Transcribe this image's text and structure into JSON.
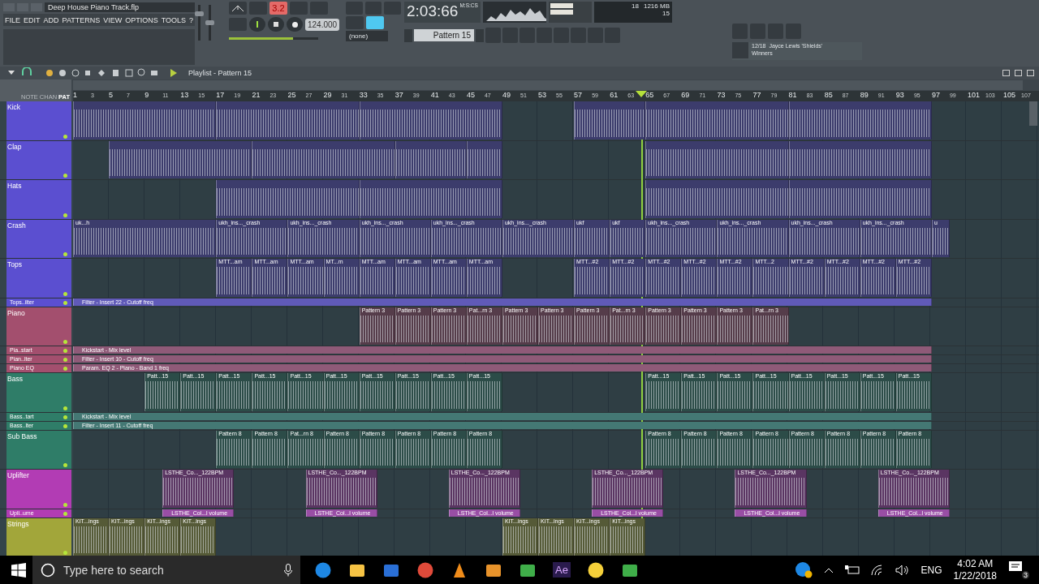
{
  "window": {
    "title": "Deep House Piano Track.flp"
  },
  "menu": [
    "FILE",
    "EDIT",
    "ADD",
    "PATTERNS",
    "VIEW",
    "OPTIONS",
    "TOOLS",
    "?"
  ],
  "master": {
    "volume": {
      "level": 0.8
    },
    "pitch": {
      "level": 0.5
    }
  },
  "transport": {
    "mode_button": "3.2",
    "playing": true,
    "tempo": "124.000",
    "pattern_picker": "(none)",
    "time": "2:03:66",
    "time_units": "M:S:CS",
    "position": {
      "level": 0.72
    }
  },
  "pattern_selector": "Pattern 15",
  "monitor": {
    "cpu": "18",
    "memory": "1216 MB",
    "polyphony": "15"
  },
  "hint": {
    "counter": "12/18",
    "title": "Jayce Lewis 'Shields'",
    "subtitle": "Winners"
  },
  "playlist": {
    "title": "Playlist - Pattern 15",
    "modes": [
      {
        "label": "NOTE",
        "selected": false
      },
      {
        "label": "CHAN",
        "selected": false
      },
      {
        "label": "PAT",
        "selected": true
      }
    ],
    "ruler": [
      "1",
      "3",
      "5",
      "7",
      "9",
      "11",
      "13",
      "15",
      "17",
      "19",
      "21",
      "23",
      "25",
      "27",
      "29",
      "31",
      "33",
      "35",
      "37",
      "39",
      "41",
      "43",
      "45",
      "47",
      "49",
      "51",
      "53",
      "55",
      "57",
      "59",
      "61",
      "63",
      "65",
      "67",
      "69",
      "71",
      "73",
      "75",
      "77",
      "79",
      "81",
      "83",
      "85",
      "87",
      "89",
      "91",
      "93",
      "95",
      "97",
      "99",
      "101",
      "103",
      "105",
      "107"
    ],
    "playhead": {
      "level": 0.594
    },
    "tracks": [
      {
        "name": "Kick",
        "kind": "main",
        "color": "#5b4fd0",
        "clips": [
          {
            "kind": "block"
          },
          {
            "kind": "block"
          },
          {
            "kind": "block"
          },
          {
            "kind": "rest"
          },
          {
            "kind": "rest"
          },
          {
            "kind": "longclip"
          },
          {
            "kind": "block"
          },
          {
            "kind": "block"
          }
        ]
      },
      {
        "name": "Clap",
        "kind": "main",
        "color": "#5b4fd0",
        "clips": [
          {
            "kind": "rest"
          },
          {
            "kind": "block"
          },
          {
            "kind": "block"
          },
          {
            "kind": "longclip"
          },
          {
            "kind": "clip"
          },
          {
            "kind": "rest"
          },
          {
            "kind": "rest"
          },
          {
            "kind": "rest"
          },
          {
            "kind": "rest"
          },
          {
            "kind": "block"
          },
          {
            "kind": "block"
          }
        ]
      },
      {
        "name": "Hats",
        "kind": "main",
        "color": "#5b4fd0",
        "clips": [
          {
            "kind": "rest"
          },
          {
            "kind": "rest"
          },
          {
            "kind": "rest"
          },
          {
            "kind": "rest"
          },
          {
            "kind": "block"
          },
          {
            "kind": "block"
          },
          {
            "kind": "rest"
          },
          {
            "kind": "rest"
          },
          {
            "kind": "rest"
          },
          {
            "kind": "rest"
          },
          {
            "kind": "block"
          },
          {
            "kind": "block"
          }
        ]
      },
      {
        "name": "Crash",
        "kind": "main",
        "color": "#5b4fd0",
        "clips": [
          {
            "kind": "block",
            "label": "uk...h"
          },
          {
            "kind": "longclip",
            "label": "ukh_ins..._crash"
          },
          {
            "kind": "longclip",
            "label": "ukh_ins..._crash"
          },
          {
            "kind": "longclip",
            "label": "ukh_ins..._crash"
          },
          {
            "kind": "longclip",
            "label": "ukh_ins..._crash"
          },
          {
            "kind": "longclip",
            "label": "ukh_ins..._crash"
          },
          {
            "kind": "clip",
            "label": "ukf"
          },
          {
            "kind": "clip",
            "label": "ukf"
          },
          {
            "kind": "longclip",
            "label": "ukh_ins..._crash"
          },
          {
            "kind": "longclip",
            "label": "ukh_ins..._crash"
          },
          {
            "kind": "longclip",
            "label": "ukh_ins..._crash"
          },
          {
            "kind": "longclip",
            "label": "ukh_ins..._crash"
          },
          {
            "kind": "halfclip",
            "label": "u"
          }
        ]
      },
      {
        "name": "Tops",
        "kind": "main",
        "color": "#5b4fd0",
        "clips": [
          {
            "kind": "rest"
          },
          {
            "kind": "rest"
          },
          {
            "kind": "rest"
          },
          {
            "kind": "rest"
          },
          {
            "kind": "clip",
            "label": "MTT...am"
          },
          {
            "kind": "clip",
            "label": "MTT...am"
          },
          {
            "kind": "clip",
            "label": "MTT...am"
          },
          {
            "kind": "clip",
            "label": "MT...m"
          },
          {
            "kind": "clip",
            "label": "MTT...am"
          },
          {
            "kind": "clip",
            "label": "MTT...am"
          },
          {
            "kind": "clip",
            "label": "MTT...am"
          },
          {
            "kind": "clip",
            "label": "MTT...am"
          },
          {
            "kind": "rest"
          },
          {
            "kind": "rest"
          },
          {
            "kind": "clip",
            "label": "MTT...#2"
          },
          {
            "kind": "clip",
            "label": "MTT...#2"
          },
          {
            "kind": "clip",
            "label": "MTT...#2"
          },
          {
            "kind": "clip",
            "label": "MTT...#2"
          },
          {
            "kind": "clip",
            "label": "MTT...#2"
          },
          {
            "kind": "clip",
            "label": "MTT...2"
          },
          {
            "kind": "clip",
            "label": "MTT...#2"
          },
          {
            "kind": "clip",
            "label": "MTT...#2"
          },
          {
            "kind": "clip",
            "label": "MTT...#2"
          },
          {
            "kind": "clip",
            "label": "MTT...#2"
          }
        ]
      },
      {
        "name": "Tops..ilter",
        "kind": "automation",
        "color": "#5b4fd0",
        "clips": [
          {
            "kind": "full",
            "label": "Filter - Insert 22 - Cutoff freq"
          }
        ]
      },
      {
        "name": "Piano",
        "kind": "main",
        "color": "#a34f6e",
        "clips": [
          {
            "kind": "rest"
          },
          {
            "kind": "rest"
          },
          {
            "kind": "rest"
          },
          {
            "kind": "rest"
          },
          {
            "kind": "rest"
          },
          {
            "kind": "rest"
          },
          {
            "kind": "rest"
          },
          {
            "kind": "rest"
          },
          {
            "kind": "clip",
            "label": "Pattern 3"
          },
          {
            "kind": "clip",
            "label": "Pattern 3"
          },
          {
            "kind": "clip",
            "label": "Pattern 3"
          },
          {
            "kind": "clip",
            "label": "Pat...rn 3"
          },
          {
            "kind": "clip",
            "label": "Pattern 3"
          },
          {
            "kind": "clip",
            "label": "Pattern 3"
          },
          {
            "kind": "clip",
            "label": "Pattern 3"
          },
          {
            "kind": "clip",
            "label": "Pat...rn 3"
          },
          {
            "kind": "clip",
            "label": "Pattern 3"
          },
          {
            "kind": "clip",
            "label": "Pattern 3"
          },
          {
            "kind": "clip",
            "label": "Pattern 3"
          },
          {
            "kind": "clip",
            "label": "Pat...rn 3"
          }
        ]
      },
      {
        "name": "Pia..start",
        "kind": "automation",
        "color": "#a34f6e",
        "clips": [
          {
            "kind": "full",
            "label": "Kickstart - Mix level"
          }
        ]
      },
      {
        "name": "Pian..lter",
        "kind": "automation",
        "color": "#a34f6e",
        "clips": [
          {
            "kind": "full",
            "label": "Filter - Insert 10 - Cutoff freq"
          }
        ]
      },
      {
        "name": "Piano EQ",
        "kind": "automation",
        "color": "#a34f6e",
        "clips": [
          {
            "kind": "full",
            "label": "Param. EQ 2 - Piano - Band 1 freq"
          }
        ]
      },
      {
        "name": "Bass",
        "kind": "main",
        "color": "#2f7d68",
        "clips": [
          {
            "kind": "rest"
          },
          {
            "kind": "rest"
          },
          {
            "kind": "clip",
            "label": "Patt...15"
          },
          {
            "kind": "clip",
            "label": "Patt...15"
          },
          {
            "kind": "clip",
            "label": "Patt...15"
          },
          {
            "kind": "clip",
            "label": "Patt...15"
          },
          {
            "kind": "clip",
            "label": "Patt...15"
          },
          {
            "kind": "clip",
            "label": "Patt...15"
          },
          {
            "kind": "clip",
            "label": "Patt...15"
          },
          {
            "kind": "clip",
            "label": "Patt...15"
          },
          {
            "kind": "clip",
            "label": "Patt...15"
          },
          {
            "kind": "clip",
            "label": "Patt...15"
          },
          {
            "kind": "rest"
          },
          {
            "kind": "rest"
          },
          {
            "kind": "rest"
          },
          {
            "kind": "rest"
          },
          {
            "kind": "clip",
            "label": "Patt...15"
          },
          {
            "kind": "clip",
            "label": "Patt...15"
          },
          {
            "kind": "clip",
            "label": "Patt...15"
          },
          {
            "kind": "clip",
            "label": "Patt...15"
          },
          {
            "kind": "clip",
            "label": "Patt...15"
          },
          {
            "kind": "clip",
            "label": "Patt...15"
          },
          {
            "kind": "clip",
            "label": "Patt...15"
          },
          {
            "kind": "clip",
            "label": "Patt...15"
          }
        ]
      },
      {
        "name": "Bass..tart",
        "kind": "automation",
        "color": "#2f7d68",
        "clips": [
          {
            "kind": "full",
            "label": "Kickstart - Mix level"
          }
        ]
      },
      {
        "name": "Bass..lter",
        "kind": "automation",
        "color": "#2f7d68",
        "clips": [
          {
            "kind": "full",
            "label": "Filter - Insert 11 - Cutoff freq"
          }
        ]
      },
      {
        "name": "Sub Bass",
        "kind": "main",
        "color": "#2f7d68",
        "clips": [
          {
            "kind": "rest"
          },
          {
            "kind": "rest"
          },
          {
            "kind": "rest"
          },
          {
            "kind": "rest"
          },
          {
            "kind": "clip",
            "label": "Pattern 8"
          },
          {
            "kind": "clip",
            "label": "Pattern 8"
          },
          {
            "kind": "clip",
            "label": "Pat...rn 8"
          },
          {
            "kind": "clip",
            "label": "Pattern 8"
          },
          {
            "kind": "clip",
            "label": "Pattern 8"
          },
          {
            "kind": "clip",
            "label": "Pattern 8"
          },
          {
            "kind": "clip",
            "label": "Pattern 8"
          },
          {
            "kind": "clip",
            "label": "Pattern 8"
          },
          {
            "kind": "rest"
          },
          {
            "kind": "rest"
          },
          {
            "kind": "rest"
          },
          {
            "kind": "rest"
          },
          {
            "kind": "clip",
            "label": "Pattern 8"
          },
          {
            "kind": "clip",
            "label": "Pattern 8"
          },
          {
            "kind": "clip",
            "label": "Pattern 8"
          },
          {
            "kind": "clip",
            "label": "Pattern 8"
          },
          {
            "kind": "clip",
            "label": "Pattern 8"
          },
          {
            "kind": "clip",
            "label": "Pattern 8"
          },
          {
            "kind": "clip",
            "label": "Pattern 8"
          },
          {
            "kind": "clip",
            "label": "Pattern 8"
          }
        ]
      },
      {
        "name": "Uplifter",
        "kind": "main",
        "color": "#b23cb4",
        "clips": [
          {
            "kind": "rest"
          },
          {
            "kind": "rest"
          },
          {
            "kind": "halfrest"
          },
          {
            "kind": "longclip",
            "label": "LSTHE_Co..._122BPM"
          },
          {
            "kind": "rest"
          },
          {
            "kind": "rest"
          },
          {
            "kind": "longclip",
            "label": "LSTHE_Co..._122BPM"
          },
          {
            "kind": "rest"
          },
          {
            "kind": "rest"
          },
          {
            "kind": "longclip",
            "label": "LSTHE_Co..._122BPM"
          },
          {
            "kind": "rest"
          },
          {
            "kind": "rest"
          },
          {
            "kind": "longclip",
            "label": "LSTHE_Co..._122BPM"
          },
          {
            "kind": "rest"
          },
          {
            "kind": "rest"
          },
          {
            "kind": "longclip",
            "label": "LSTHE_Co..._122BPM"
          },
          {
            "kind": "rest"
          },
          {
            "kind": "rest"
          },
          {
            "kind": "longclip",
            "label": "LSTHE_Co..._122BPM"
          }
        ]
      },
      {
        "name": "Upli..ume",
        "kind": "automation",
        "color": "#b23cb4",
        "clips": [
          {
            "kind": "rest"
          },
          {
            "kind": "rest"
          },
          {
            "kind": "halfrest"
          },
          {
            "kind": "longclip",
            "label": "LSTHE_Col...l volume"
          },
          {
            "kind": "rest"
          },
          {
            "kind": "rest"
          },
          {
            "kind": "longclip",
            "label": "LSTHE_Col...l volume"
          },
          {
            "kind": "rest"
          },
          {
            "kind": "rest"
          },
          {
            "kind": "longclip",
            "label": "LSTHE_Col...l volume"
          },
          {
            "kind": "rest"
          },
          {
            "kind": "rest"
          },
          {
            "kind": "longclip",
            "label": "LSTHE_Col...l volume"
          },
          {
            "kind": "rest"
          },
          {
            "kind": "rest"
          },
          {
            "kind": "longclip",
            "label": "LSTHE_Col...l volume"
          },
          {
            "kind": "rest"
          },
          {
            "kind": "rest"
          },
          {
            "kind": "longclip",
            "label": "LSTHE_Col...l volume"
          }
        ]
      },
      {
        "name": "Strings",
        "kind": "main",
        "color": "#a2a63a",
        "clips": [
          {
            "kind": "clip",
            "label": "KIT...ings"
          },
          {
            "kind": "clip",
            "label": "KIT...ings"
          },
          {
            "kind": "clip",
            "label": "KIT...ings"
          },
          {
            "kind": "clip",
            "label": "KIT...ings"
          },
          {
            "kind": "rest"
          },
          {
            "kind": "rest"
          },
          {
            "kind": "rest"
          },
          {
            "kind": "rest"
          },
          {
            "kind": "rest"
          },
          {
            "kind": "rest"
          },
          {
            "kind": "rest"
          },
          {
            "kind": "rest"
          },
          {
            "kind": "clip",
            "label": "KIT...ings"
          },
          {
            "kind": "clip",
            "label": "KIT...ings"
          },
          {
            "kind": "clip",
            "label": "KIT...ings"
          },
          {
            "kind": "clip",
            "label": "KIT...ings"
          }
        ]
      }
    ]
  },
  "taskbar": {
    "search_placeholder": "Type here to search",
    "apps": [
      {
        "kind": "edge"
      },
      {
        "kind": "folder"
      },
      {
        "kind": "store"
      },
      {
        "kind": "chrome"
      },
      {
        "kind": "cone"
      },
      {
        "kind": "fruit"
      },
      {
        "kind": "sheet"
      },
      {
        "kind": "ae",
        "label": "Ae"
      },
      {
        "kind": "face"
      },
      {
        "kind": "sheet"
      }
    ],
    "language": "ENG",
    "time": "4:02 AM",
    "date": "1/22/2018",
    "notifications": "3"
  }
}
